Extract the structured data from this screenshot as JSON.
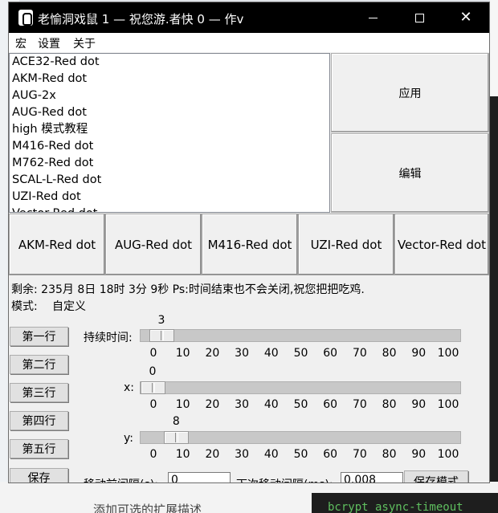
{
  "background": {
    "bottom_text": "添加可选的扩展描述",
    "bottom_code": "bcrypt  async-timeout"
  },
  "window": {
    "title": "老愉洞戏鼠 1 — 祝您游.者快 0 — 作v"
  },
  "menu": [
    "宏",
    "设置",
    "关于"
  ],
  "presets": [
    "ACE32-Red dot",
    "AKM-Red dot",
    "AUG-2x",
    "AUG-Red dot",
    "high 模式教程",
    "M416-Red dot",
    "M762-Red dot",
    "SCAL-L-Red dot",
    "UZI-Red dot",
    "Vector-Red dot"
  ],
  "buttons": {
    "apply": "应用",
    "edit": "编辑",
    "save": "保存",
    "save_mode": "保存模式"
  },
  "quick_presets": [
    "AKM-Red dot",
    "AUG-Red dot",
    "M416-Red dot",
    "UZI-Red dot",
    "Vector-Red dot"
  ],
  "status": {
    "remaining": "剩余: 235月 8日 18时 3分 9秒  Ps:时间结束也不会关闭,祝您把把吃鸡.",
    "mode_label": "模式:",
    "mode_value": "自定义"
  },
  "row_buttons": [
    "第一行",
    "第二行",
    "第三行",
    "第四行",
    "第五行"
  ],
  "sliders": [
    {
      "label": "持续时间:",
      "value": 3,
      "fraction": 0.03
    },
    {
      "label": "x:",
      "value": 0,
      "fraction": 0.0
    },
    {
      "label": "y:",
      "value": 8,
      "fraction": 0.08
    }
  ],
  "ticks": [
    "0",
    "10",
    "20",
    "30",
    "40",
    "50",
    "60",
    "70",
    "80",
    "90",
    "100"
  ],
  "intervals": {
    "before_label": "移动前间隔(s):",
    "before_value": "0",
    "next_label": "下次移动间隔(ms):",
    "next_value": "0.008"
  }
}
